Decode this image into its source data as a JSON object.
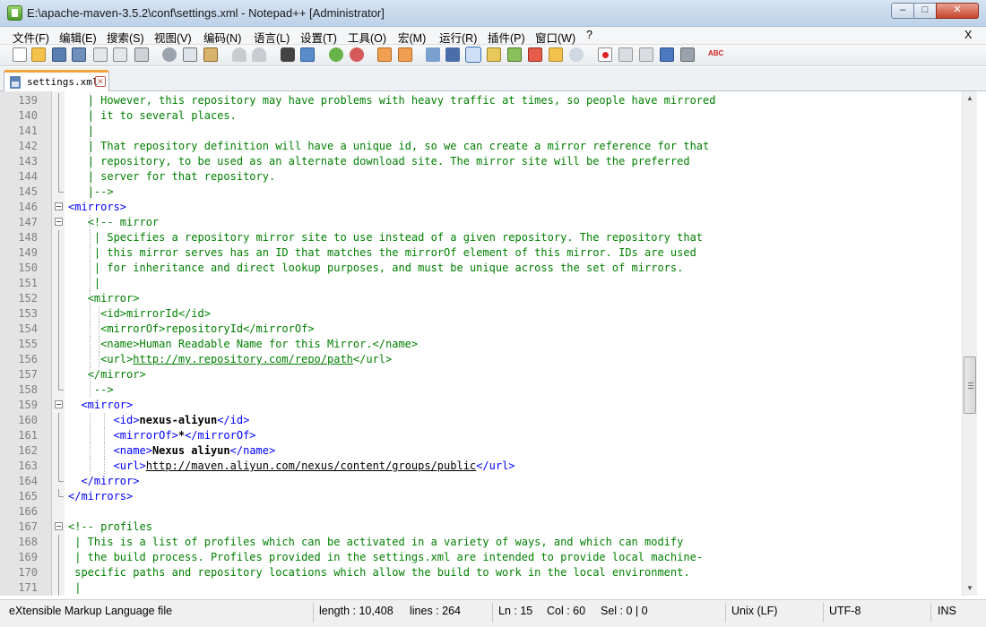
{
  "window": {
    "title": "E:\\apache-maven-3.5.2\\conf\\settings.xml - Notepad++ [Administrator]",
    "minimize": "–",
    "maximize": "□",
    "close": "✕"
  },
  "menu": [
    "文件(F)",
    "编辑(E)",
    "搜索(S)",
    "视图(V)",
    "编码(N)",
    "语言(L)",
    "设置(T)",
    "工具(O)",
    "宏(M)",
    "运行(R)",
    "插件(P)",
    "窗口(W)",
    "?"
  ],
  "menu_close": "X",
  "toolbar_icons": [
    "new-file",
    "open-file",
    "save",
    "save-all",
    "close",
    "close-all",
    "print",
    "cut",
    "copy",
    "paste",
    "undo",
    "redo",
    "find",
    "replace",
    "zoom-in",
    "zoom-out",
    "sync-v",
    "sync-h",
    "word-wrap",
    "all-chars",
    "indent-guide",
    "doc-map",
    "function-list",
    "folder-workspace",
    "monitor",
    "record-macro",
    "stop-record",
    "play-macro",
    "run-macro-multiple",
    "save-macro",
    "spell-check"
  ],
  "tab": {
    "label": "settings.xml"
  },
  "editor": {
    "lines": [
      {
        "n": "139",
        "fold": "line",
        "parts": [
          [
            "g1",
            ""
          ],
          [
            "c",
            "| However, this repository may have problems with heavy traffic at times, so people have mirrored"
          ]
        ]
      },
      {
        "n": "140",
        "fold": "line",
        "parts": [
          [
            "g1",
            ""
          ],
          [
            "c",
            "| it to several places."
          ]
        ]
      },
      {
        "n": "141",
        "fold": "line",
        "parts": [
          [
            "g1",
            ""
          ],
          [
            "c",
            "|"
          ]
        ]
      },
      {
        "n": "142",
        "fold": "line",
        "parts": [
          [
            "g1",
            ""
          ],
          [
            "c",
            "| That repository definition will have a unique id, so we can create a mirror reference for that"
          ]
        ]
      },
      {
        "n": "143",
        "fold": "line",
        "parts": [
          [
            "g1",
            ""
          ],
          [
            "c",
            "| repository, to be used as an alternate download site. The mirror site will be the preferred"
          ]
        ]
      },
      {
        "n": "144",
        "fold": "line",
        "parts": [
          [
            "g1",
            ""
          ],
          [
            "c",
            "| server for that repository."
          ]
        ]
      },
      {
        "n": "145",
        "fold": "end",
        "parts": [
          [
            "g1",
            ""
          ],
          [
            "c",
            "|-->"
          ]
        ]
      },
      {
        "n": "146",
        "fold": "box",
        "parts": [
          [
            "t",
            "<mirrors>"
          ]
        ]
      },
      {
        "n": "147",
        "fold": "box",
        "parts": [
          [
            "g1",
            ""
          ],
          [
            "c",
            "<!-- mirror"
          ]
        ]
      },
      {
        "n": "148",
        "fold": "line",
        "parts": [
          [
            "g1",
            ""
          ],
          [
            "c",
            " | Specifies a repository mirror site to use instead of a given repository. The repository that"
          ]
        ]
      },
      {
        "n": "149",
        "fold": "line",
        "parts": [
          [
            "g1",
            ""
          ],
          [
            "c",
            " | this mirror serves has an ID that matches the mirrorOf element of this mirror. IDs are used"
          ]
        ]
      },
      {
        "n": "150",
        "fold": "line",
        "parts": [
          [
            "g1",
            ""
          ],
          [
            "c",
            " | for inheritance and direct lookup purposes, and must be unique across the set of mirrors."
          ]
        ]
      },
      {
        "n": "151",
        "fold": "line",
        "parts": [
          [
            "g1",
            ""
          ],
          [
            "c",
            " |"
          ]
        ]
      },
      {
        "n": "152",
        "fold": "line",
        "parts": [
          [
            "g1",
            ""
          ],
          [
            "c",
            "<mirror>"
          ]
        ]
      },
      {
        "n": "153",
        "fold": "line",
        "parts": [
          [
            "g2",
            ""
          ],
          [
            "c",
            "<id>mirrorId</id>"
          ]
        ]
      },
      {
        "n": "154",
        "fold": "line",
        "parts": [
          [
            "g2",
            ""
          ],
          [
            "c",
            "<mirrorOf>repositoryId</mirrorOf>"
          ]
        ]
      },
      {
        "n": "155",
        "fold": "line",
        "parts": [
          [
            "g2",
            ""
          ],
          [
            "c",
            "<name>Human Readable Name for this Mirror.</name>"
          ]
        ]
      },
      {
        "n": "156",
        "fold": "line",
        "parts": [
          [
            "g2",
            ""
          ],
          [
            "c",
            "<url>"
          ],
          [
            "cu",
            "http://my.repository.com/repo/path"
          ],
          [
            "c",
            "</url>"
          ]
        ]
      },
      {
        "n": "157",
        "fold": "line",
        "parts": [
          [
            "g1",
            ""
          ],
          [
            "c",
            "</mirror>"
          ]
        ]
      },
      {
        "n": "158",
        "fold": "end",
        "parts": [
          [
            "g1",
            ""
          ],
          [
            "c",
            " -->"
          ]
        ]
      },
      {
        "n": "159",
        "fold": "box",
        "parts": [
          [
            "g0",
            ""
          ],
          [
            "t",
            "<mirror>"
          ]
        ]
      },
      {
        "n": "160",
        "fold": "line",
        "parts": [
          [
            "g3",
            ""
          ],
          [
            "t",
            "<id>"
          ],
          [
            "xb",
            "nexus-aliyun"
          ],
          [
            "t",
            "</id>"
          ]
        ]
      },
      {
        "n": "161",
        "fold": "line",
        "parts": [
          [
            "g3",
            ""
          ],
          [
            "t",
            "<mirrorOf>"
          ],
          [
            "xb",
            "*"
          ],
          [
            "t",
            "</mirrorOf>"
          ]
        ]
      },
      {
        "n": "162",
        "fold": "line",
        "parts": [
          [
            "g3",
            ""
          ],
          [
            "t",
            "<name>"
          ],
          [
            "xb",
            "Nexus aliyun"
          ],
          [
            "t",
            "</name>"
          ]
        ]
      },
      {
        "n": "163",
        "fold": "line",
        "parts": [
          [
            "g3",
            ""
          ],
          [
            "t",
            "<url>"
          ],
          [
            "u",
            "http://maven.aliyun.com/nexus/content/groups/public"
          ],
          [
            "t",
            "</url>"
          ]
        ]
      },
      {
        "n": "164",
        "fold": "end",
        "parts": [
          [
            "g0",
            ""
          ],
          [
            "t",
            "</mirror>"
          ]
        ]
      },
      {
        "n": "165",
        "fold": "end",
        "parts": [
          [
            "t",
            "</mirrors>"
          ]
        ]
      },
      {
        "n": "166",
        "fold": "",
        "parts": []
      },
      {
        "n": "167",
        "fold": "box",
        "parts": [
          [
            "c",
            "<!-- profiles"
          ]
        ]
      },
      {
        "n": "168",
        "fold": "line",
        "parts": [
          [
            "c",
            " | This is a list of profiles which can be activated in a variety of ways, and which can modify"
          ]
        ]
      },
      {
        "n": "169",
        "fold": "line",
        "parts": [
          [
            "c",
            " | the build process. Profiles provided in the settings.xml are intended to provide local machine-"
          ]
        ]
      },
      {
        "n": "170",
        "fold": "line",
        "parts": [
          [
            "c",
            " specific paths and repository locations which allow the build to work in the local environment."
          ]
        ]
      },
      {
        "n": "171",
        "fold": "line",
        "parts": [
          [
            "c",
            " |"
          ]
        ]
      }
    ]
  },
  "status": {
    "file_type": "eXtensible Markup Language file",
    "length": "length : 10,408",
    "lines": "lines : 264",
    "ln": "Ln : 15",
    "col": "Col : 60",
    "sel": "Sel : 0 | 0",
    "eol": "Unix (LF)",
    "encoding": "UTF-8",
    "mode": "INS"
  }
}
